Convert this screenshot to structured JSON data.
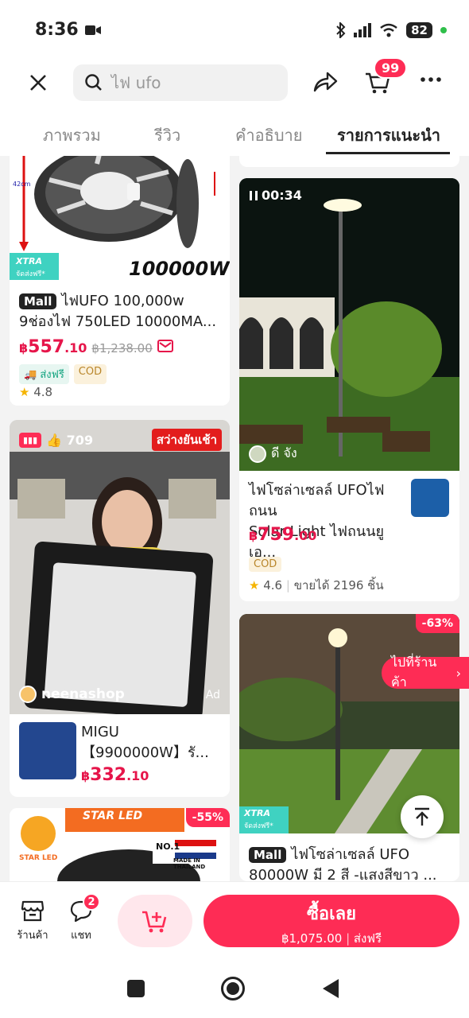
{
  "status": {
    "time": "8:36",
    "battery": "82"
  },
  "header": {
    "search_text": "ไฟ ufo",
    "cart_count": "99"
  },
  "tabs": [
    {
      "label": "ภาพรวม"
    },
    {
      "label": "รีวิว"
    },
    {
      "label": "คำอธิบาย"
    },
    {
      "label": "รายการแนะนำ"
    }
  ],
  "products": {
    "p1": {
      "wattage_text": "100000W",
      "xtra_label": "XTRA",
      "xtra_sub": "จัดส่งฟรี*",
      "mall_label": "Mall",
      "title_line1": "ไฟUFO 100,000w",
      "title_line2": "9ช่องไฟ 750LED 10000MA...",
      "price_currency": "฿",
      "price_main": "557",
      "price_decimal": ".10",
      "original_price": "฿1,238.00",
      "tag_free": "ส่งฟรี",
      "tag_cod": "COD",
      "rating": "4.8"
    },
    "p2": {
      "video_time": "00:34",
      "creator": "ดี จัง",
      "title_line1": "ไฟโซล่าเซลล์ UFOไฟถนน",
      "title_line2": "Solar Light ไฟถนนยูเอ...",
      "price_currency": "฿",
      "price_main": "759",
      "price_decimal": ".00",
      "tag_cod": "COD",
      "rating": "4.6",
      "sold": "ขายได้ 2196 ชิ้น"
    },
    "p3": {
      "likes": "709",
      "banner": "สว่างยันเช้า",
      "shop": "neenashop",
      "ad": "Ad",
      "title_line1": "MIGU",
      "title_line2": "【9900000W】รั...",
      "price_currency": "฿",
      "price_main": "332",
      "price_decimal": ".10"
    },
    "p4": {
      "discount": "-63%",
      "goto_shop": "ไปที่ร้านค้า",
      "xtra_label": "XTRA",
      "xtra_sub": "จัดส่งฟรี*",
      "mall_label": "Mall",
      "title_line1": "ไฟโซล่าเซลล์ UFO",
      "title_line2": "80000W มี 2 สี -แสงสีขาว ..."
    },
    "p5": {
      "brand": "STAR LED",
      "brand_logo": "STAR LED",
      "discount": "-55%",
      "made_in": "MADE IN THAILAND",
      "no1": "NO.1"
    }
  },
  "bottom": {
    "shop_label": "ร้านค้า",
    "chat_label": "แชท",
    "chat_badge": "2",
    "buy_label": "ซื้อเลย",
    "buy_price": "฿1,075.00",
    "buy_shipping": "ส่งฟรี"
  },
  "colors": {
    "accent": "#fe2c55",
    "price": "#e6154a"
  }
}
